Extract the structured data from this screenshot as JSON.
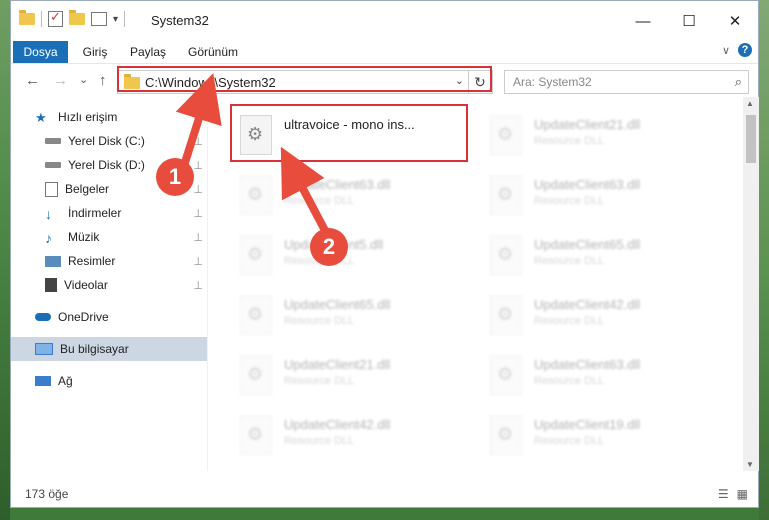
{
  "window": {
    "title": "System32"
  },
  "window_controls": {
    "minimize": "—",
    "maximize": "☐",
    "close": "✕"
  },
  "ribbon": {
    "tabs": [
      {
        "label": "Dosya"
      },
      {
        "label": "Giriş"
      },
      {
        "label": "Paylaş"
      },
      {
        "label": "Görünüm"
      }
    ],
    "expand_glyph": "∨",
    "help_glyph": "?"
  },
  "address": {
    "path": "C:\\Windows\\System32",
    "search_placeholder": "Ara: System32"
  },
  "nav": {
    "back": "←",
    "forward": "→",
    "recent": "⌄",
    "up": "↑",
    "refresh": "↻",
    "search_glyph": "⌕"
  },
  "sidebar": {
    "items": [
      {
        "label": "Hızlı erişim",
        "icon": "star-icon",
        "pinned": false
      },
      {
        "label": "Yerel Disk (C:)",
        "icon": "drive-icon",
        "pinned": true
      },
      {
        "label": "Yerel Disk (D:)",
        "icon": "drive-icon",
        "pinned": true
      },
      {
        "label": "Belgeler",
        "icon": "documents-icon",
        "pinned": true
      },
      {
        "label": "İndirmeler",
        "icon": "download-icon",
        "pinned": true
      },
      {
        "label": "Müzik",
        "icon": "music-icon",
        "pinned": true
      },
      {
        "label": "Resimler",
        "icon": "pictures-icon",
        "pinned": true
      },
      {
        "label": "Videolar",
        "icon": "video-icon",
        "pinned": true
      },
      {
        "label": "OneDrive",
        "icon": "cloud-icon",
        "pinned": false
      },
      {
        "label": "Bu bilgisayar",
        "icon": "computer-icon",
        "pinned": false,
        "selected": true
      },
      {
        "label": "Ağ",
        "icon": "network-icon",
        "pinned": false
      }
    ],
    "pin_glyph": "📌"
  },
  "files": [
    {
      "name": "ultravoice - mono ins...",
      "kind": "",
      "highlighted": true
    },
    {
      "name": "UpdateClient21.dll",
      "kind": "Resource DLL"
    },
    {
      "name": "UpdateClient63.dll",
      "kind": "Resource DLL"
    },
    {
      "name": "UpdateClient63.dll",
      "kind": "Resource DLL"
    },
    {
      "name": "UpdateClient5.dll",
      "kind": "Resource DLL"
    },
    {
      "name": "UpdateClient65.dll",
      "kind": "Resource DLL"
    },
    {
      "name": "UpdateClient65.dll",
      "kind": "Resource DLL"
    },
    {
      "name": "UpdateClient42.dll",
      "kind": "Resource DLL"
    },
    {
      "name": "UpdateClient21.dll",
      "kind": "Resource DLL"
    },
    {
      "name": "UpdateClient63.dll",
      "kind": "Resource DLL"
    },
    {
      "name": "UpdateClient42.dll",
      "kind": "Resource DLL"
    },
    {
      "name": "UpdateClient19.dll",
      "kind": "Resource DLL"
    }
  ],
  "status": {
    "item_count": "173 öğe"
  },
  "annotations": [
    {
      "number": "1"
    },
    {
      "number": "2"
    }
  ],
  "colors": {
    "accent": "#1a6fb6",
    "highlight_box": "#d9303a",
    "badge": "#e74c3c"
  }
}
